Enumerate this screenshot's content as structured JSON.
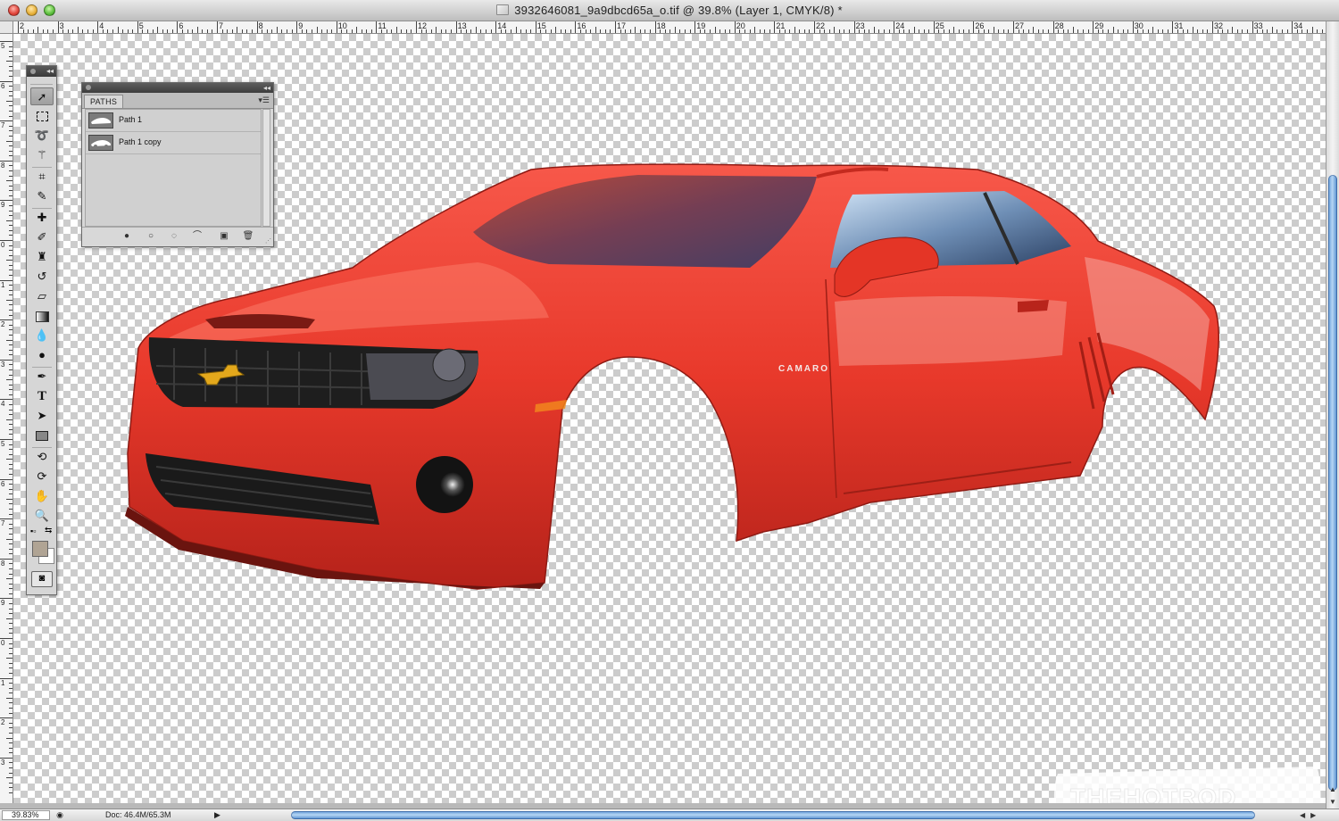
{
  "window": {
    "title": "3932646081_9a9dbcd65a_o.tif @ 39.8% (Layer 1, CMYK/8) *"
  },
  "ruler_top_labels": [
    "2",
    "3",
    "4",
    "5",
    "6",
    "7",
    "8",
    "9",
    "10",
    "11",
    "12",
    "13",
    "14",
    "15",
    "16",
    "17",
    "18",
    "19",
    "20",
    "21",
    "22",
    "23",
    "24",
    "25",
    "26",
    "27",
    "28",
    "29",
    "30",
    "31",
    "32",
    "33",
    "34"
  ],
  "ruler_left_labels": [
    "5",
    "6",
    "7",
    "8",
    "9",
    "0",
    "1",
    "2",
    "3",
    "4",
    "5",
    "6",
    "7",
    "8",
    "9",
    "0",
    "1",
    "2",
    "3"
  ],
  "panels": {
    "paths": {
      "tab_label": "PATHS",
      "items": [
        {
          "name": "Path 1"
        },
        {
          "name": "Path 1 copy"
        }
      ],
      "footer_icons": [
        "fill-path-icon",
        "stroke-path-icon",
        "load-selection-icon",
        "make-work-path-icon",
        "new-path-icon",
        "delete-path-icon"
      ]
    }
  },
  "toolbox": {
    "tools": [
      "move-tool-icon",
      "marquee-tool-icon",
      "lasso-tool-icon",
      "magic-wand-icon",
      "crop-tool-icon",
      "eyedropper-icon",
      "healing-brush-icon",
      "brush-icon",
      "clone-stamp-icon",
      "history-brush-icon",
      "eraser-icon",
      "gradient-icon",
      "blur-icon",
      "dodge-icon",
      "pen-tool-icon",
      "type-tool-icon",
      "path-selection-icon",
      "rectangle-tool-icon",
      "3d-rotate-icon",
      "3d-orbit-icon",
      "hand-tool-icon",
      "zoom-tool-icon"
    ],
    "type_glyph": "T",
    "foreground_color": "#b0a494",
    "background_color": "#ffffff"
  },
  "status": {
    "zoom": "39.83%",
    "doc": "Doc: 46.4M/65.3M"
  },
  "colors": {
    "car_body": "#e8392b",
    "scroll_thumb": "#6aa3dd"
  },
  "canvas": {
    "emblem_text": "CAMARO",
    "watermark_text": "THEHOTROD"
  }
}
